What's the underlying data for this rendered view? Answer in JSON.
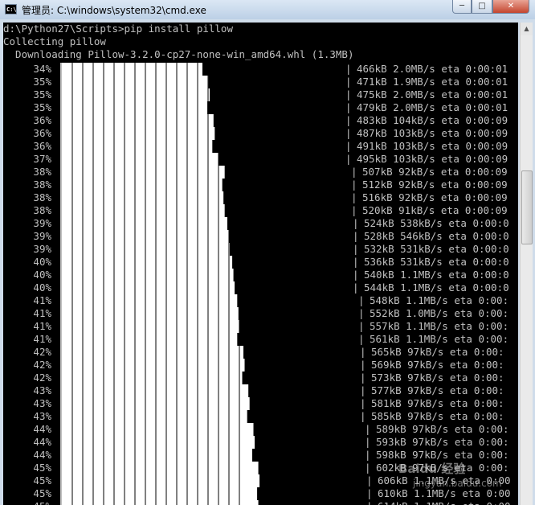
{
  "window": {
    "title": "管理员: C:\\windows\\system32\\cmd.exe",
    "icon": "cmd-icon",
    "buttons": {
      "minimize": "minimize-icon",
      "maximize": "maximize-icon",
      "close": "close-icon"
    }
  },
  "console": {
    "header_lines": [
      "d:\\Python27\\Scripts>pip install pillow",
      "Collecting pillow",
      "  Downloading Pillow-3.2.0-cp27-none-win_amd64.whl (1.3MB)"
    ],
    "progress_rows": [
      {
        "pct": "34%",
        "stat": "466kB 2.0MB/s eta 0:00:01"
      },
      {
        "pct": "35%",
        "stat": "471kB 1.9MB/s eta 0:00:01"
      },
      {
        "pct": "35%",
        "stat": "475kB 2.0MB/s eta 0:00:01"
      },
      {
        "pct": "35%",
        "stat": "479kB 2.0MB/s eta 0:00:01"
      },
      {
        "pct": "36%",
        "stat": "483kB 104kB/s eta 0:00:09"
      },
      {
        "pct": "36%",
        "stat": "487kB 103kB/s eta 0:00:09"
      },
      {
        "pct": "36%",
        "stat": "491kB 103kB/s eta 0:00:09"
      },
      {
        "pct": "37%",
        "stat": "495kB 103kB/s eta 0:00:09"
      },
      {
        "pct": "38%",
        "stat": "507kB 92kB/s eta 0:00:09"
      },
      {
        "pct": "38%",
        "stat": "512kB 92kB/s eta 0:00:09"
      },
      {
        "pct": "38%",
        "stat": "516kB 92kB/s eta 0:00:09"
      },
      {
        "pct": "38%",
        "stat": "520kB 91kB/s eta 0:00:09"
      },
      {
        "pct": "39%",
        "stat": "524kB 538kB/s eta 0:00:0"
      },
      {
        "pct": "39%",
        "stat": "528kB 546kB/s eta 0:00:0"
      },
      {
        "pct": "39%",
        "stat": "532kB 531kB/s eta 0:00:0"
      },
      {
        "pct": "40%",
        "stat": "536kB 531kB/s eta 0:00:0"
      },
      {
        "pct": "40%",
        "stat": "540kB 1.1MB/s eta 0:00:0"
      },
      {
        "pct": "40%",
        "stat": "544kB 1.1MB/s eta 0:00:0"
      },
      {
        "pct": "41%",
        "stat": "548kB 1.1MB/s eta 0:00:"
      },
      {
        "pct": "41%",
        "stat": "552kB 1.0MB/s eta 0:00:"
      },
      {
        "pct": "41%",
        "stat": "557kB 1.1MB/s eta 0:00:"
      },
      {
        "pct": "41%",
        "stat": "561kB 1.1MB/s eta 0:00:"
      },
      {
        "pct": "42%",
        "stat": "565kB 97kB/s eta 0:00:"
      },
      {
        "pct": "42%",
        "stat": "569kB 97kB/s eta 0:00:"
      },
      {
        "pct": "42%",
        "stat": "573kB 97kB/s eta 0:00:"
      },
      {
        "pct": "43%",
        "stat": "577kB 97kB/s eta 0:00:"
      },
      {
        "pct": "43%",
        "stat": "581kB 97kB/s eta 0:00:"
      },
      {
        "pct": "43%",
        "stat": "585kB 97kB/s eta 0:00:"
      },
      {
        "pct": "44%",
        "stat": "589kB 97kB/s eta 0:00:"
      },
      {
        "pct": "44%",
        "stat": "593kB 97kB/s eta 0:00:"
      },
      {
        "pct": "44%",
        "stat": "598kB 97kB/s eta 0:00:"
      },
      {
        "pct": "45%",
        "stat": "602kB 97kB/s eta 0:00:"
      },
      {
        "pct": "45%",
        "stat": "606kB 1.1MB/s eta 0:00"
      },
      {
        "pct": "45%",
        "stat": "610kB 1.1MB/s eta 0:00"
      },
      {
        "pct": "45%",
        "stat": "614kB 1.1MB/s eta 0:00"
      }
    ],
    "colors": {
      "background": "#000000",
      "text": "#c0c0c0",
      "progress_fill": "#ffffff"
    }
  },
  "watermark": {
    "text": "Baidu 经验",
    "subtext": "jingyan.baidu.com"
  }
}
